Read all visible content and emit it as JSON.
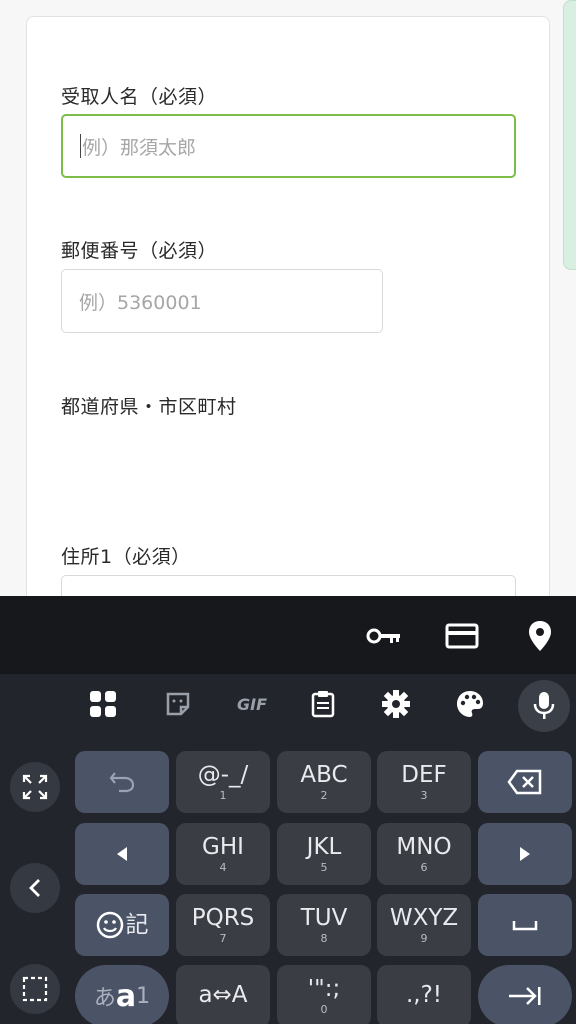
{
  "form": {
    "recipient_label": "受取人名（必須）",
    "recipient_placeholder": "例）那須太郎",
    "postal_label": "郵便番号（必須）",
    "postal_placeholder": "例）5360001",
    "prefecture_label": "都道府県・市区町村",
    "address1_label": "住所1（必須）"
  },
  "autofill": {
    "icons": [
      "key-icon",
      "card-icon",
      "location-icon"
    ]
  },
  "toolbar": {
    "icons": [
      "apps-grid-icon",
      "sticker-icon",
      "gif-icon",
      "clipboard-icon",
      "gear-icon",
      "palette-icon",
      "mic-icon"
    ],
    "gif_label": "GIF"
  },
  "keyboard": {
    "row1": [
      {
        "main": "@-_/",
        "sub": "1"
      },
      {
        "main": "ABC",
        "sub": "2"
      },
      {
        "main": "DEF",
        "sub": "3"
      }
    ],
    "row2": [
      {
        "main": "GHI",
        "sub": "4"
      },
      {
        "main": "JKL",
        "sub": "5"
      },
      {
        "main": "MNO",
        "sub": "6"
      }
    ],
    "row3": [
      {
        "main": "PQRS",
        "sub": "7"
      },
      {
        "main": "TUV",
        "sub": "8"
      },
      {
        "main": "WXYZ",
        "sub": "9"
      }
    ],
    "row4": [
      {
        "main": "a⇔A",
        "sub": ""
      },
      {
        "main": "'\":;",
        "sub": "0"
      },
      {
        "main": ".,?!",
        "sub": ""
      }
    ],
    "emoji_key_label": "記",
    "mode_key_label": "あ",
    "mode_key_bold": "a",
    "mode_key_digit": "1",
    "colors": {
      "key": "#3a3d44",
      "func_key": "#4b5366",
      "background": "#22252b",
      "focus_border": "#7cbd4a"
    }
  }
}
